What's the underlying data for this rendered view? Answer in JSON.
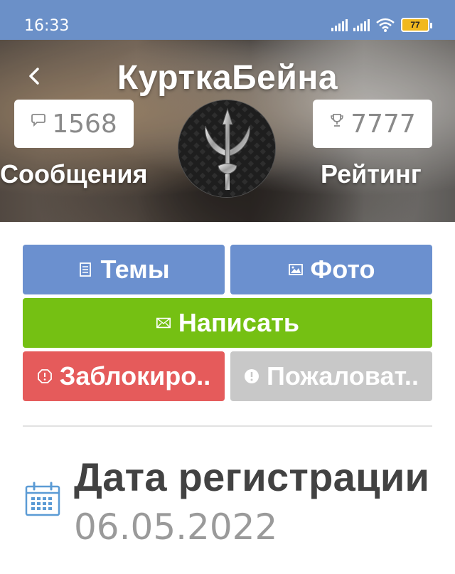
{
  "status_bar": {
    "time": "16:33",
    "battery": "77",
    "icons": [
      "signal-icon",
      "signal-icon",
      "wifi-icon",
      "battery-icon"
    ]
  },
  "header": {
    "back_icon": "chevron-left-icon",
    "title": "КурткаБейна",
    "messages": {
      "icon": "chat-bubble-icon",
      "count": "1568",
      "label": "Сообщения"
    },
    "rating": {
      "icon": "trophy-icon",
      "count": "7777",
      "label": "Рейтинг"
    },
    "avatar_icon": "trident-emblem-icon"
  },
  "actions": {
    "topics": {
      "icon": "document-icon",
      "label": "Темы"
    },
    "photos": {
      "icon": "image-icon",
      "label": "Фото"
    },
    "write": {
      "icon": "envelope-icon",
      "label": "Написать"
    },
    "block": {
      "icon": "block-icon",
      "label": "Заблокиро.."
    },
    "report": {
      "icon": "alert-icon",
      "label": "Пожаловат.."
    }
  },
  "registration": {
    "icon": "calendar-icon",
    "title": "Дата регистрации",
    "date": "06.05.2022"
  },
  "colors": {
    "status_bar": "#6b90c8",
    "primary_button": "#6b90cf",
    "write_button": "#75c013",
    "block_button": "#e55b5b",
    "report_button": "#c8c8c8",
    "calendar_icon": "#5b9bd5"
  }
}
